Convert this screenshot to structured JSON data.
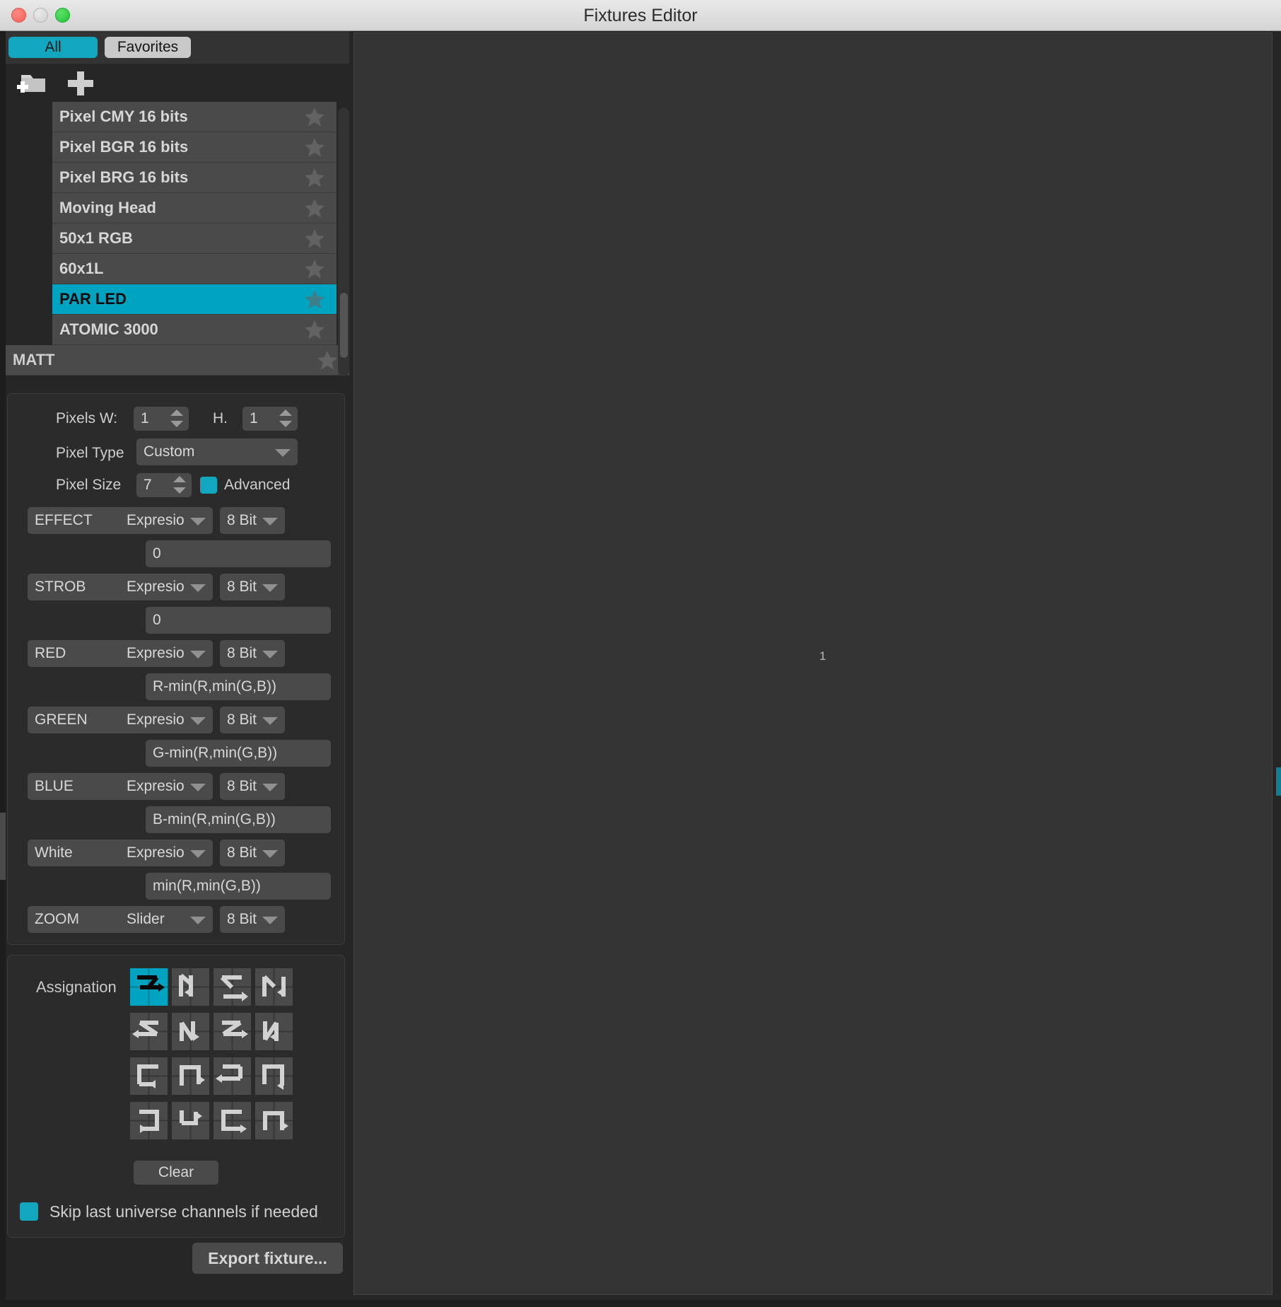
{
  "window": {
    "title": "Fixtures Editor",
    "controls": [
      "close",
      "minimize",
      "zoom"
    ]
  },
  "tabs": {
    "all_label": "All",
    "favorites_label": "Favorites",
    "active": "All"
  },
  "list_toolbar": {
    "new_folder_icon": "new-folder-icon",
    "add_icon": "plus-icon"
  },
  "fixture_list": {
    "group_label": "MATT",
    "items": [
      {
        "label": "Pixel CMY 16 bits",
        "selected": false,
        "favorite_icon": "star-icon"
      },
      {
        "label": "Pixel BGR 16 bits",
        "selected": false,
        "favorite_icon": "star-icon"
      },
      {
        "label": "Pixel BRG 16 bits",
        "selected": false,
        "favorite_icon": "star-icon"
      },
      {
        "label": "Moving Head",
        "selected": false,
        "favorite_icon": "star-icon"
      },
      {
        "label": "50x1 RGB",
        "selected": false,
        "favorite_icon": "star-icon"
      },
      {
        "label": "60x1L",
        "selected": false,
        "favorite_icon": "star-icon"
      },
      {
        "label": "PAR LED",
        "selected": true,
        "favorite_icon": "star-icon"
      },
      {
        "label": "ATOMIC 3000",
        "selected": false,
        "favorite_icon": "star-icon"
      }
    ]
  },
  "properties": {
    "pixels_w_label": "Pixels W:",
    "pixels_w_value": "1",
    "pixels_h_label": "H.",
    "pixels_h_value": "1",
    "pixel_type_label": "Pixel Type",
    "pixel_type_value": "Custom",
    "pixel_size_label": "Pixel Size",
    "pixel_size_value": "7",
    "advanced_label": "Advanced",
    "advanced_checked": true
  },
  "channels": [
    {
      "name": "EFFECT",
      "mode": "Expresio",
      "bits": "8 Bit",
      "expression": "0"
    },
    {
      "name": "STROB",
      "mode": "Expresio",
      "bits": "8 Bit",
      "expression": "0"
    },
    {
      "name": "RED",
      "mode": "Expresio",
      "bits": "8 Bit",
      "expression": "R-min(R,min(G,B))"
    },
    {
      "name": "GREEN",
      "mode": "Expresio",
      "bits": "8 Bit",
      "expression": "G-min(R,min(G,B))"
    },
    {
      "name": "BLUE",
      "mode": "Expresio",
      "bits": "8 Bit",
      "expression": "B-min(R,min(G,B))"
    },
    {
      "name": "White",
      "mode": "Expresio",
      "bits": "8 Bit",
      "expression": "min(R,min(G,B))"
    },
    {
      "name": "ZOOM",
      "mode": "Slider",
      "bits": "8 Bit",
      "expression": null
    }
  ],
  "assignation": {
    "label": "Assignation",
    "clear_label": "Clear",
    "selected_index": 0,
    "patterns": [
      "zigzag-right-down",
      "zigzag-down-right",
      "zigzag-right-up",
      "zigzag-up-right",
      "zigzag-left-down",
      "zigzag-down-left",
      "zigzag-left-up",
      "zigzag-up-left",
      "spiral-right-in",
      "spiral-up-in",
      "spiral-left-in",
      "spiral-down-in",
      "spiral-left-out",
      "spiral-down-out",
      "spiral-right-out",
      "spiral-up-out"
    ]
  },
  "skip_option": {
    "label": "Skip last universe channels if needed",
    "checked": true
  },
  "export": {
    "label": "Export fixture..."
  },
  "canvas": {
    "pixel_label": "1"
  },
  "colors": {
    "accent": "#00a3c0",
    "tab_active": "#12a7bf",
    "panel_bg": "#262626",
    "field_bg": "#4a4a4a",
    "canvas_bg": "#343434"
  }
}
